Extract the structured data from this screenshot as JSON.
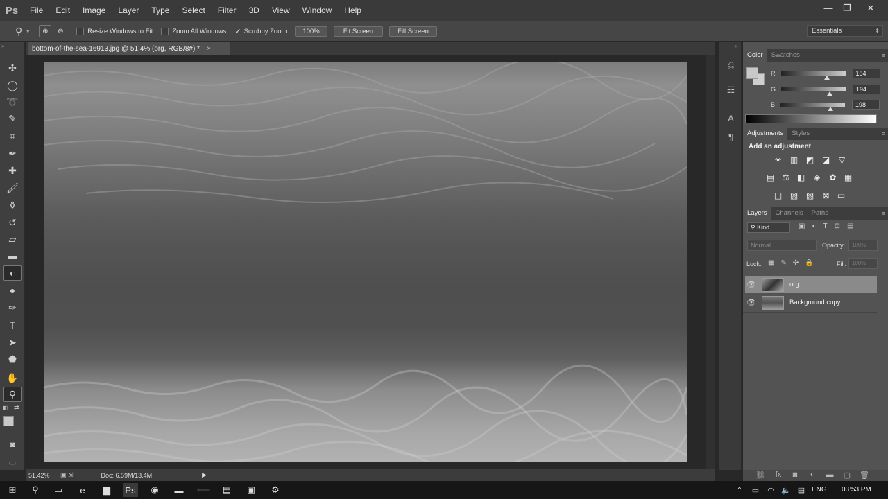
{
  "app": {
    "logo": "Ps"
  },
  "menu": [
    "File",
    "Edit",
    "Image",
    "Layer",
    "Type",
    "Select",
    "Filter",
    "3D",
    "View",
    "Window",
    "Help"
  ],
  "window_controls": {
    "minimize": "—",
    "restore": "❐",
    "close": "✕"
  },
  "options": {
    "resize_windows": "Resize Windows to Fit",
    "zoom_all": "Zoom All Windows",
    "scrubby_zoom": "Scrubby Zoom",
    "btn_100": "100%",
    "fit_screen": "Fit Screen",
    "fill_screen": "Fill Screen",
    "workspace": "Essentials"
  },
  "document": {
    "tab_title": "bottom-of-the-sea-16913.jpg @ 51.4% (org, RGB/8#) *",
    "close": "×",
    "zoom": "51.42%",
    "doc_size": "Doc: 6.59M/13.4M"
  },
  "color_panel": {
    "tabs": [
      "Color",
      "Swatches"
    ],
    "r_label": "R",
    "r": "184",
    "g_label": "G",
    "g": "194",
    "b_label": "B",
    "b": "198",
    "fg_color": "#b8c2c6"
  },
  "adjustments_panel": {
    "tabs": [
      "Adjustments",
      "Styles"
    ],
    "heading": "Add an adjustment"
  },
  "layers_panel": {
    "tabs": [
      "Layers",
      "Channels",
      "Paths"
    ],
    "kind": "Kind",
    "blend_mode": "Normal",
    "opacity_label": "Opacity:",
    "opacity": "100%",
    "lock_label": "Lock:",
    "fill_label": "Fill:",
    "fill": "100%",
    "layers": [
      {
        "name": "org"
      },
      {
        "name": "Background copy"
      }
    ]
  },
  "taskbar": {
    "lang": "ENG",
    "time": "03:53 PM"
  }
}
